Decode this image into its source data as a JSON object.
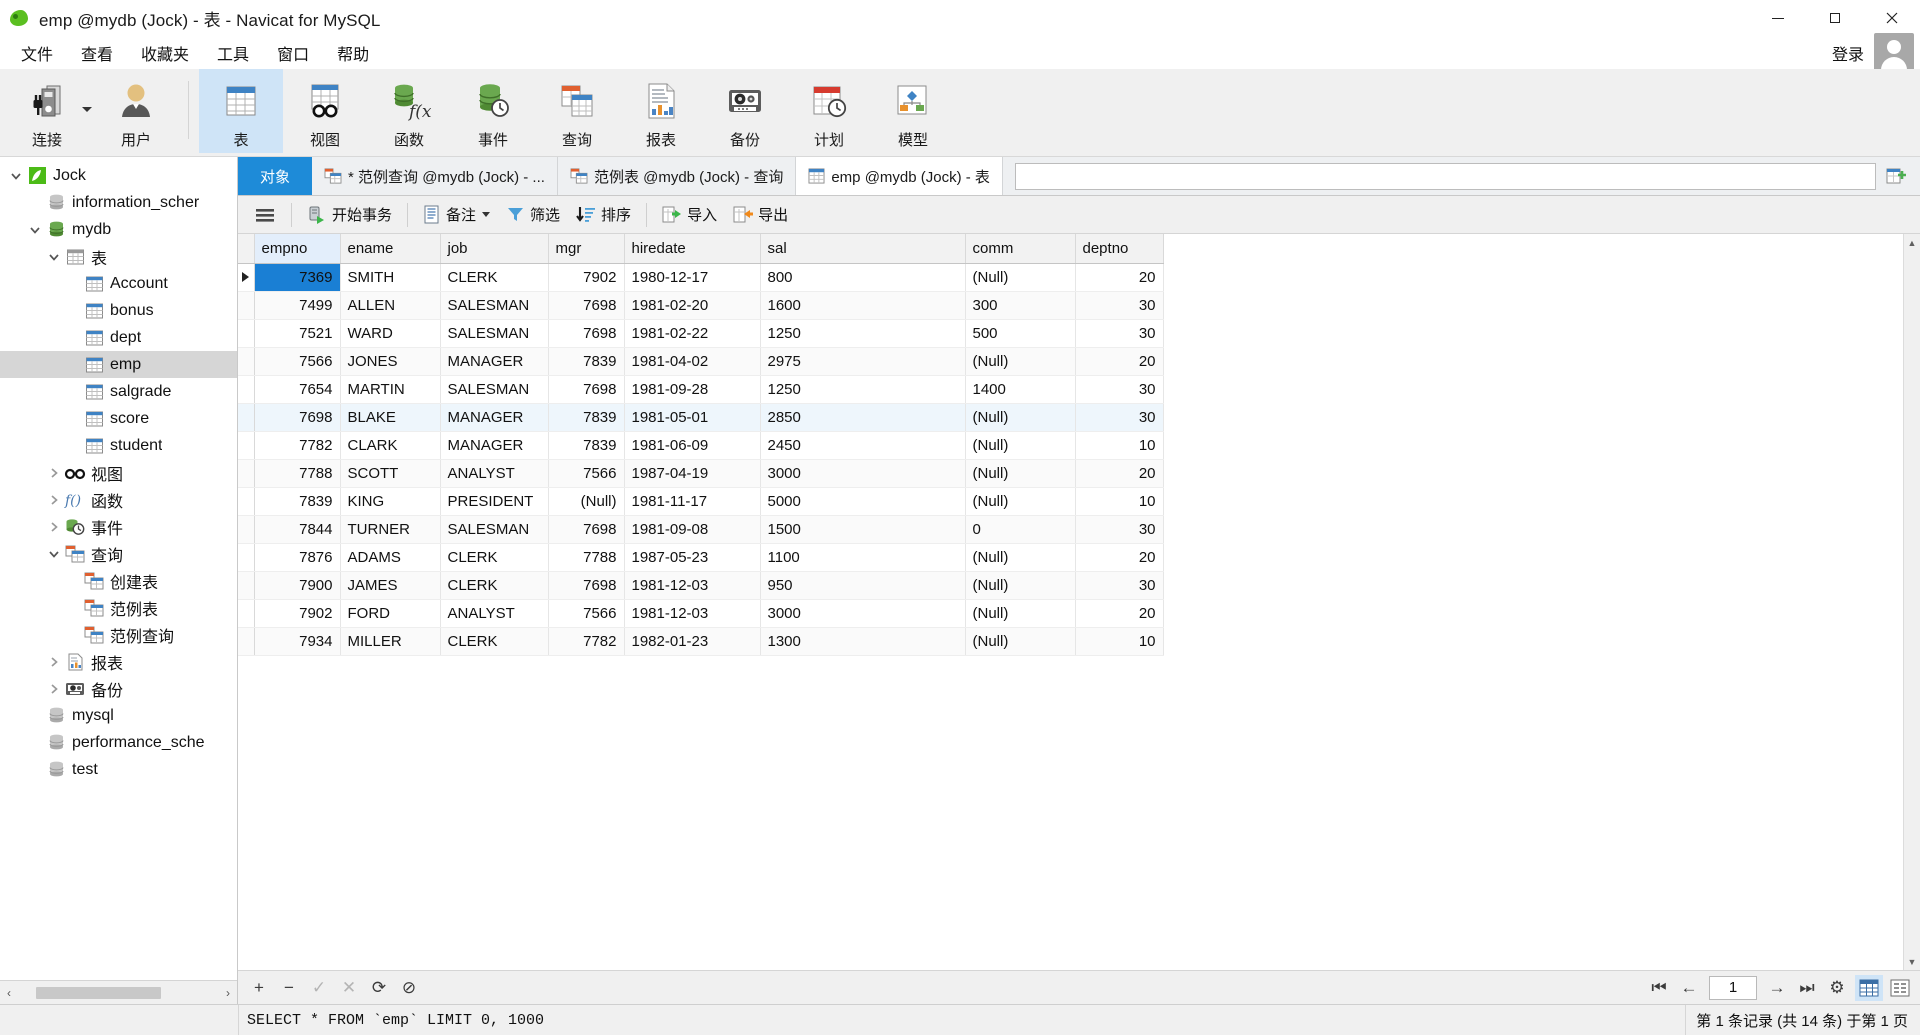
{
  "window": {
    "title": "emp @mydb (Jock) - 表 - Navicat for MySQL",
    "app_icon": "navicat-leaf-icon",
    "minimize": "minimize-icon",
    "maximize": "maximize-icon",
    "close": "close-icon"
  },
  "menubar": {
    "items": [
      {
        "label": "文件",
        "name": "menu-file"
      },
      {
        "label": "查看",
        "name": "menu-view"
      },
      {
        "label": "收藏夹",
        "name": "menu-favorites"
      },
      {
        "label": "工具",
        "name": "menu-tools"
      },
      {
        "label": "窗口",
        "name": "menu-window"
      },
      {
        "label": "帮助",
        "name": "menu-help"
      }
    ],
    "login_label": "登录"
  },
  "toolbar": {
    "items": [
      {
        "label": "连接",
        "icon": "connection-icon",
        "active": false,
        "dropdown": true
      },
      {
        "label": "用户",
        "icon": "user-icon",
        "active": false,
        "dropdown": false
      },
      {
        "label": "表",
        "icon": "table-icon",
        "active": true,
        "dropdown": false
      },
      {
        "label": "视图",
        "icon": "view-glasses-icon",
        "active": false,
        "dropdown": false
      },
      {
        "label": "函数",
        "icon": "function-fx-icon",
        "active": false,
        "dropdown": false
      },
      {
        "label": "事件",
        "icon": "event-clock-icon",
        "active": false,
        "dropdown": false
      },
      {
        "label": "查询",
        "icon": "query-icon",
        "active": false,
        "dropdown": false
      },
      {
        "label": "报表",
        "icon": "report-chart-icon",
        "active": false,
        "dropdown": false
      },
      {
        "label": "备份",
        "icon": "backup-tape-icon",
        "active": false,
        "dropdown": false
      },
      {
        "label": "计划",
        "icon": "schedule-calendar-icon",
        "active": false,
        "dropdown": false
      },
      {
        "label": "模型",
        "icon": "model-diagram-icon",
        "active": false,
        "dropdown": false
      }
    ]
  },
  "sidebar": {
    "tree": [
      {
        "label": "Jock",
        "depth": 0,
        "icon": "connection-leaf-icon",
        "twisty": "expanded",
        "selected": false
      },
      {
        "label": "information_scher",
        "depth": 1,
        "icon": "database-gray-icon",
        "twisty": "none",
        "selected": false
      },
      {
        "label": "mydb",
        "depth": 1,
        "icon": "database-green-icon",
        "twisty": "expanded",
        "selected": false
      },
      {
        "label": "表",
        "depth": 2,
        "icon": "folder-table-icon",
        "twisty": "expanded",
        "selected": false
      },
      {
        "label": "Account",
        "depth": 3,
        "icon": "table-icon",
        "twisty": "none",
        "selected": false
      },
      {
        "label": "bonus",
        "depth": 3,
        "icon": "table-icon",
        "twisty": "none",
        "selected": false
      },
      {
        "label": "dept",
        "depth": 3,
        "icon": "table-icon",
        "twisty": "none",
        "selected": false
      },
      {
        "label": "emp",
        "depth": 3,
        "icon": "table-icon",
        "twisty": "none",
        "selected": true
      },
      {
        "label": "salgrade",
        "depth": 3,
        "icon": "table-icon",
        "twisty": "none",
        "selected": false
      },
      {
        "label": "score",
        "depth": 3,
        "icon": "table-icon",
        "twisty": "none",
        "selected": false
      },
      {
        "label": "student",
        "depth": 3,
        "icon": "table-icon",
        "twisty": "none",
        "selected": false
      },
      {
        "label": "视图",
        "depth": 2,
        "icon": "view-glasses-icon",
        "twisty": "collapsed",
        "selected": false
      },
      {
        "label": "函数",
        "depth": 2,
        "icon": "function-fx-icon",
        "twisty": "collapsed",
        "selected": false
      },
      {
        "label": "事件",
        "depth": 2,
        "icon": "event-clock-icon",
        "twisty": "collapsed",
        "selected": false
      },
      {
        "label": "查询",
        "depth": 2,
        "icon": "query-icon",
        "twisty": "expanded",
        "selected": false
      },
      {
        "label": "创建表",
        "depth": 3,
        "icon": "query-icon",
        "twisty": "none",
        "selected": false
      },
      {
        "label": "范例表",
        "depth": 3,
        "icon": "query-icon",
        "twisty": "none",
        "selected": false
      },
      {
        "label": "范例查询",
        "depth": 3,
        "icon": "query-icon",
        "twisty": "none",
        "selected": false
      },
      {
        "label": "报表",
        "depth": 2,
        "icon": "report-chart-icon",
        "twisty": "collapsed",
        "selected": false
      },
      {
        "label": "备份",
        "depth": 2,
        "icon": "backup-tape-icon",
        "twisty": "collapsed",
        "selected": false
      },
      {
        "label": "mysql",
        "depth": 1,
        "icon": "database-gray-icon",
        "twisty": "none",
        "selected": false
      },
      {
        "label": "performance_sche",
        "depth": 1,
        "icon": "database-gray-icon",
        "twisty": "none",
        "selected": false
      },
      {
        "label": "test",
        "depth": 1,
        "icon": "database-gray-icon",
        "twisty": "none",
        "selected": false
      }
    ]
  },
  "tabstrip": {
    "object_tab": "对象",
    "tabs": [
      {
        "label": "* 范例查询 @mydb (Jock) - ...",
        "icon": "query-icon",
        "current": false
      },
      {
        "label": "范例表 @mydb (Jock) - 查询",
        "icon": "query-icon",
        "current": false
      },
      {
        "label": "emp @mydb (Jock) - 表",
        "icon": "table-icon",
        "current": true
      }
    ],
    "new_tab_icon": "new-tab-icon"
  },
  "gridbar": {
    "menu_icon": "hamburger-icon",
    "buttons": [
      {
        "label": "开始事务",
        "icon": "begin-transaction-icon",
        "caret": false
      },
      {
        "label": "备注",
        "icon": "note-icon",
        "caret": true
      },
      {
        "label": "筛选",
        "icon": "filter-icon",
        "caret": false
      },
      {
        "label": "排序",
        "icon": "sort-icon",
        "caret": false
      },
      {
        "label": "导入",
        "icon": "import-icon",
        "caret": false
      },
      {
        "label": "导出",
        "icon": "export-icon",
        "caret": false
      }
    ]
  },
  "grid": {
    "columns": [
      "empno",
      "ename",
      "job",
      "mgr",
      "hiredate",
      "sal",
      "comm",
      "deptno"
    ],
    "null_text": "(Null)",
    "selected_cell": {
      "row": 0,
      "col": 0
    },
    "rows": [
      {
        "empno": "7369",
        "ename": "SMITH",
        "job": "CLERK",
        "mgr": "7902",
        "hiredate": "1980-12-17",
        "sal": "800",
        "comm": "(Null)",
        "deptno": "20"
      },
      {
        "empno": "7499",
        "ename": "ALLEN",
        "job": "SALESMAN",
        "mgr": "7698",
        "hiredate": "1981-02-20",
        "sal": "1600",
        "comm": "300",
        "deptno": "30"
      },
      {
        "empno": "7521",
        "ename": "WARD",
        "job": "SALESMAN",
        "mgr": "7698",
        "hiredate": "1981-02-22",
        "sal": "1250",
        "comm": "500",
        "deptno": "30"
      },
      {
        "empno": "7566",
        "ename": "JONES",
        "job": "MANAGER",
        "mgr": "7839",
        "hiredate": "1981-04-02",
        "sal": "2975",
        "comm": "(Null)",
        "deptno": "20"
      },
      {
        "empno": "7654",
        "ename": "MARTIN",
        "job": "SALESMAN",
        "mgr": "7698",
        "hiredate": "1981-09-28",
        "sal": "1250",
        "comm": "1400",
        "deptno": "30"
      },
      {
        "empno": "7698",
        "ename": "BLAKE",
        "job": "MANAGER",
        "mgr": "7839",
        "hiredate": "1981-05-01",
        "sal": "2850",
        "comm": "(Null)",
        "deptno": "30"
      },
      {
        "empno": "7782",
        "ename": "CLARK",
        "job": "MANAGER",
        "mgr": "7839",
        "hiredate": "1981-06-09",
        "sal": "2450",
        "comm": "(Null)",
        "deptno": "10"
      },
      {
        "empno": "7788",
        "ename": "SCOTT",
        "job": "ANALYST",
        "mgr": "7566",
        "hiredate": "1987-04-19",
        "sal": "3000",
        "comm": "(Null)",
        "deptno": "20"
      },
      {
        "empno": "7839",
        "ename": "KING",
        "job": "PRESIDENT",
        "mgr": "(Null)",
        "hiredate": "1981-11-17",
        "sal": "5000",
        "comm": "(Null)",
        "deptno": "10"
      },
      {
        "empno": "7844",
        "ename": "TURNER",
        "job": "SALESMAN",
        "mgr": "7698",
        "hiredate": "1981-09-08",
        "sal": "1500",
        "comm": "0",
        "deptno": "30"
      },
      {
        "empno": "7876",
        "ename": "ADAMS",
        "job": "CLERK",
        "mgr": "7788",
        "hiredate": "1987-05-23",
        "sal": "1100",
        "comm": "(Null)",
        "deptno": "20"
      },
      {
        "empno": "7900",
        "ename": "JAMES",
        "job": "CLERK",
        "mgr": "7698",
        "hiredate": "1981-12-03",
        "sal": "950",
        "comm": "(Null)",
        "deptno": "30"
      },
      {
        "empno": "7902",
        "ename": "FORD",
        "job": "ANALYST",
        "mgr": "7566",
        "hiredate": "1981-12-03",
        "sal": "3000",
        "comm": "(Null)",
        "deptno": "20"
      },
      {
        "empno": "7934",
        "ename": "MILLER",
        "job": "CLERK",
        "mgr": "7782",
        "hiredate": "1982-01-23",
        "sal": "1300",
        "comm": "(Null)",
        "deptno": "10"
      }
    ]
  },
  "bottombar": {
    "record_buttons": [
      {
        "name": "add-record-button",
        "glyph": "+"
      },
      {
        "name": "delete-record-button",
        "glyph": "−"
      },
      {
        "name": "confirm-edit-button",
        "glyph": "✓"
      },
      {
        "name": "cancel-edit-button",
        "glyph": "✕"
      },
      {
        "name": "refresh-button",
        "glyph": "⟳"
      },
      {
        "name": "stop-button",
        "glyph": "⊘"
      }
    ],
    "page_value": "1",
    "nav": [
      {
        "name": "first-page-button",
        "glyph": "⏮"
      },
      {
        "name": "prev-page-button",
        "glyph": "←"
      },
      {
        "name": "next-page-button",
        "glyph": "→"
      },
      {
        "name": "last-page-button",
        "glyph": "⏭"
      },
      {
        "name": "page-settings-button",
        "glyph": "⚙"
      }
    ],
    "view_grid_icon": "grid-view-icon",
    "view_form_icon": "form-view-icon"
  },
  "statusbar": {
    "sql": "SELECT * FROM `emp` LIMIT 0, 1000",
    "info": "第 1 条记录 (共 14 条) 于第 1 页"
  }
}
